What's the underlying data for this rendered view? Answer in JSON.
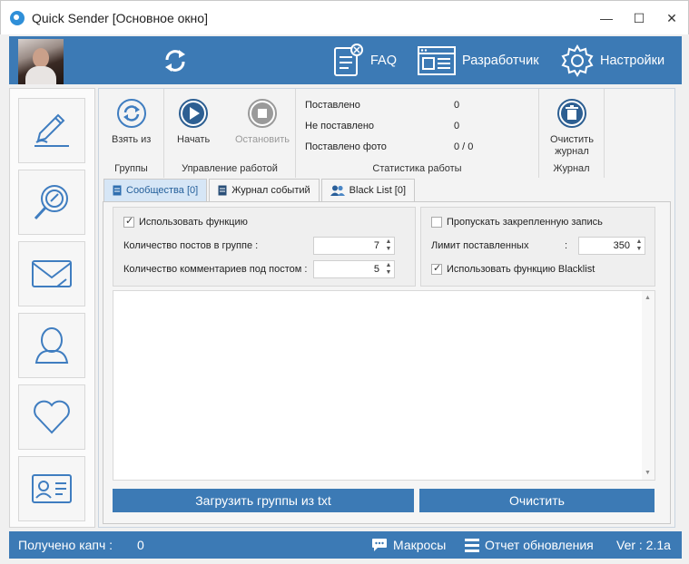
{
  "window": {
    "title": "Quick Sender [Основное окно]",
    "minimize": "—",
    "maximize": "☐",
    "close": "✕"
  },
  "header": {
    "faq_label": "FAQ",
    "developer_label": "Разработчик",
    "settings_label": "Настройки"
  },
  "sidebar": {
    "items": [
      "edit-pen-icon",
      "search-icon",
      "mail-icon",
      "user-icon",
      "heart-icon",
      "id-card-icon"
    ]
  },
  "toolbar": {
    "take_from_label": "Взять из",
    "groups_title": "Группы",
    "start_label": "Начать",
    "stop_label": "Остановить",
    "work_control_title": "Управление работой",
    "stats": [
      {
        "label": "Поставлено",
        "value": "0"
      },
      {
        "label": "Не поставлено",
        "value": "0"
      },
      {
        "label": "Поставлено фото",
        "value": "0 / 0"
      }
    ],
    "stats_title": "Статистика работы",
    "clear_log_label": "Очистить журнал",
    "log_title": "Журнал"
  },
  "tabs": [
    {
      "label": "Сообщества [0]",
      "active": true
    },
    {
      "label": "Журнал событий",
      "active": false
    },
    {
      "label": "Black List [0]",
      "active": false
    }
  ],
  "options_left": {
    "use_function_label": "Использовать функцию",
    "use_function_checked": true,
    "posts_per_group_label": "Количество постов в группе :",
    "posts_per_group_value": "7",
    "comments_per_post_label": "Количество комментариев под постом :",
    "comments_per_post_value": "5"
  },
  "options_right": {
    "skip_pinned_label": "Пропускать закрепленную запись",
    "skip_pinned_checked": false,
    "limit_label": "Лимит поставленных",
    "limit_colon": ":",
    "limit_value": "350",
    "use_blacklist_label": "Использовать функцию Blacklist",
    "use_blacklist_checked": true
  },
  "buttons": {
    "load_groups_label": "Загрузить группы из txt",
    "clear_label": "Очистить"
  },
  "statusbar": {
    "captcha_label": "Получено капч :",
    "captcha_value": "0",
    "macros_label": "Макросы",
    "update_report_label": "Отчет обновления",
    "version_label": "Ver : 2.1a"
  },
  "colors": {
    "accent": "#3c7ab5",
    "active_tab": "#d6e6f6",
    "icon_blue": "#3f7dc0"
  }
}
